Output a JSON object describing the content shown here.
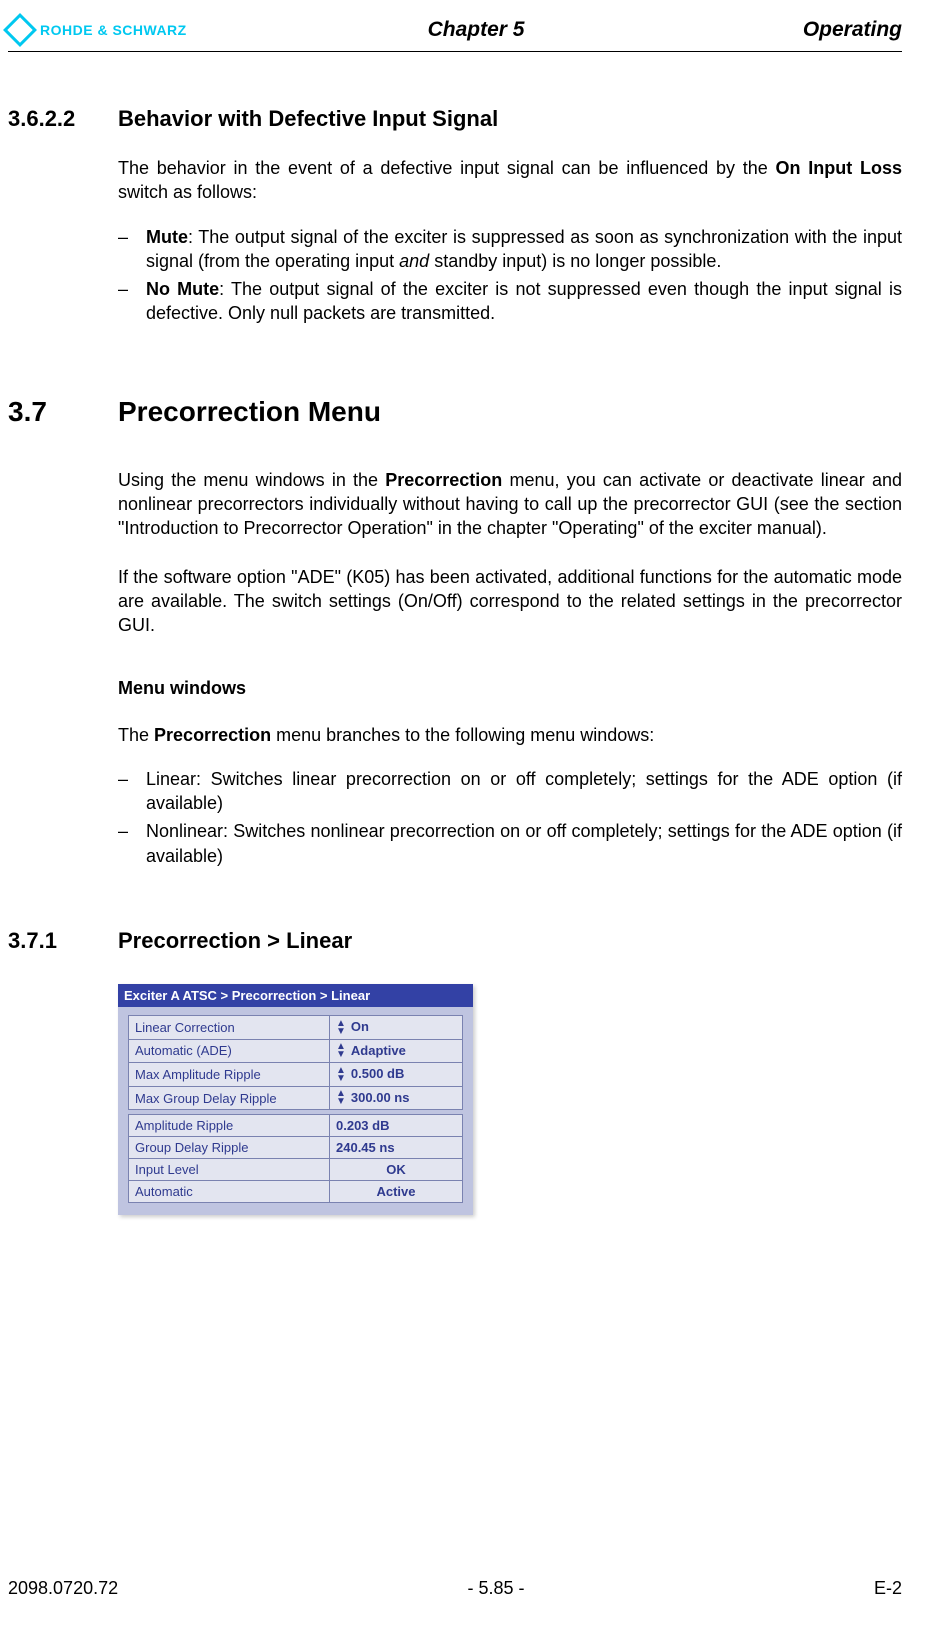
{
  "header": {
    "brand": "ROHDE & SCHWARZ",
    "chapter": "Chapter 5",
    "section": "Operating"
  },
  "sec1": {
    "num": "3.6.2.2",
    "title": "Behavior with Defective Input Signal",
    "para_a": "The behavior in the event of a defective input signal can be influenced by the ",
    "para_bold": "On Input Loss",
    "para_b": " switch as follows:",
    "bullet1_bold": "Mute",
    "bullet1_a": ": The output signal of the exciter is suppressed as soon as synchronization with the input signal (from the operating input ",
    "bullet1_it": "and",
    "bullet1_b": " standby input) is no longer possible.",
    "bullet2_bold": "No Mute",
    "bullet2_a": ": The output signal of the exciter is not suppressed even though the input signal is defective. Only null packets are transmitted."
  },
  "sec2": {
    "num": "3.7",
    "title": "Precorrection Menu",
    "para1_a": "Using the menu windows in the ",
    "para1_bold": "Precorrection",
    "para1_b": " menu, you can activate or deactivate linear and nonlinear precorrectors individually without having to call up the precorrector GUI (see the section \"Introduction to Precorrector Operation\" in the chapter \"Operating\" of the exciter manual).",
    "para2": "If the software option \"ADE\" (K05) has been activated, additional functions for the automatic mode are available. The switch settings (On/Off) correspond to the related settings in the precorrector GUI.",
    "subhead": "Menu windows",
    "para3_a": "The ",
    "para3_bold": "Precorrection",
    "para3_b": " menu branches to the following menu windows:",
    "bullet1": "Linear: Switches linear precorrection on or off completely; settings for the ADE option (if available)",
    "bullet2": "Nonlinear: Switches nonlinear precorrection on or off completely; settings for the ADE option (if available)"
  },
  "sec3": {
    "num": "3.7.1",
    "title": "Precorrection > Linear"
  },
  "figure": {
    "title": "Exciter A ATSC  > Precorrection > Linear",
    "rows1": [
      {
        "label": "Linear Correction",
        "value": "On",
        "spinner": true
      },
      {
        "label": "Automatic (ADE)",
        "value": "Adaptive",
        "spinner": true
      },
      {
        "label": "Max Amplitude Ripple",
        "value": "0.500   dB",
        "spinner": true
      },
      {
        "label": "Max Group Delay Ripple",
        "value": "300.00  ns",
        "spinner": true
      }
    ],
    "rows2": [
      {
        "label": "Amplitude Ripple",
        "value": "0.203   dB"
      },
      {
        "label": "Group Delay Ripple",
        "value": "240.45  ns"
      },
      {
        "label": "Input Level",
        "value": "OK",
        "center": true
      },
      {
        "label": "Automatic",
        "value": "Active",
        "center": true
      }
    ]
  },
  "footer": {
    "left": "2098.0720.72",
    "center": "- 5.85 -",
    "right": "E-2"
  }
}
